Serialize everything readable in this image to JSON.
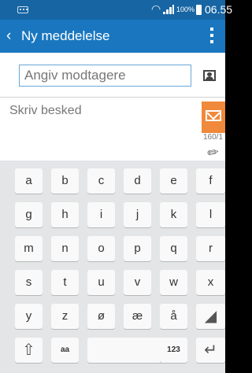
{
  "status_bar": {
    "battery_percent": "100%",
    "time": "06.55",
    "icons": [
      "keyboard-icon",
      "wifi-icon",
      "signal-icon",
      "battery-icon"
    ]
  },
  "app_bar": {
    "title": "Ny meddelelse",
    "back_icon": "back-chevron-icon",
    "menu_icon": "more-vertical-icon"
  },
  "recipient": {
    "placeholder": "Angiv modtagere",
    "value": "",
    "contact_icon": "contact-picker-icon"
  },
  "message": {
    "placeholder": "Skriv besked",
    "value": "",
    "char_counter": "160/1",
    "send_icon": "send-envelope-icon",
    "attach_icon": "paperclip-icon",
    "accent_color": "#f0893b"
  },
  "keyboard": {
    "rows": [
      [
        "a",
        "b",
        "c",
        "d",
        "e",
        "f"
      ],
      [
        "g",
        "h",
        "i",
        "j",
        "k",
        "l"
      ],
      [
        "m",
        "n",
        "o",
        "p",
        "q",
        "r"
      ],
      [
        "s",
        "t",
        "u",
        "v",
        "w",
        "x"
      ],
      [
        "y",
        "z",
        "ø",
        "æ",
        "å"
      ]
    ],
    "eraser_icon": "backspace-eraser-icon",
    "bottom_row": {
      "shift_icon": "shift-icon",
      "case_label": "aa",
      "space_label": "",
      "numbers_label": "123",
      "enter_icon": "enter-icon"
    }
  },
  "colors": {
    "status_bar": "#1765a3",
    "app_bar": "#1a77bf",
    "keyboard_bg": "#e3e5e7"
  }
}
